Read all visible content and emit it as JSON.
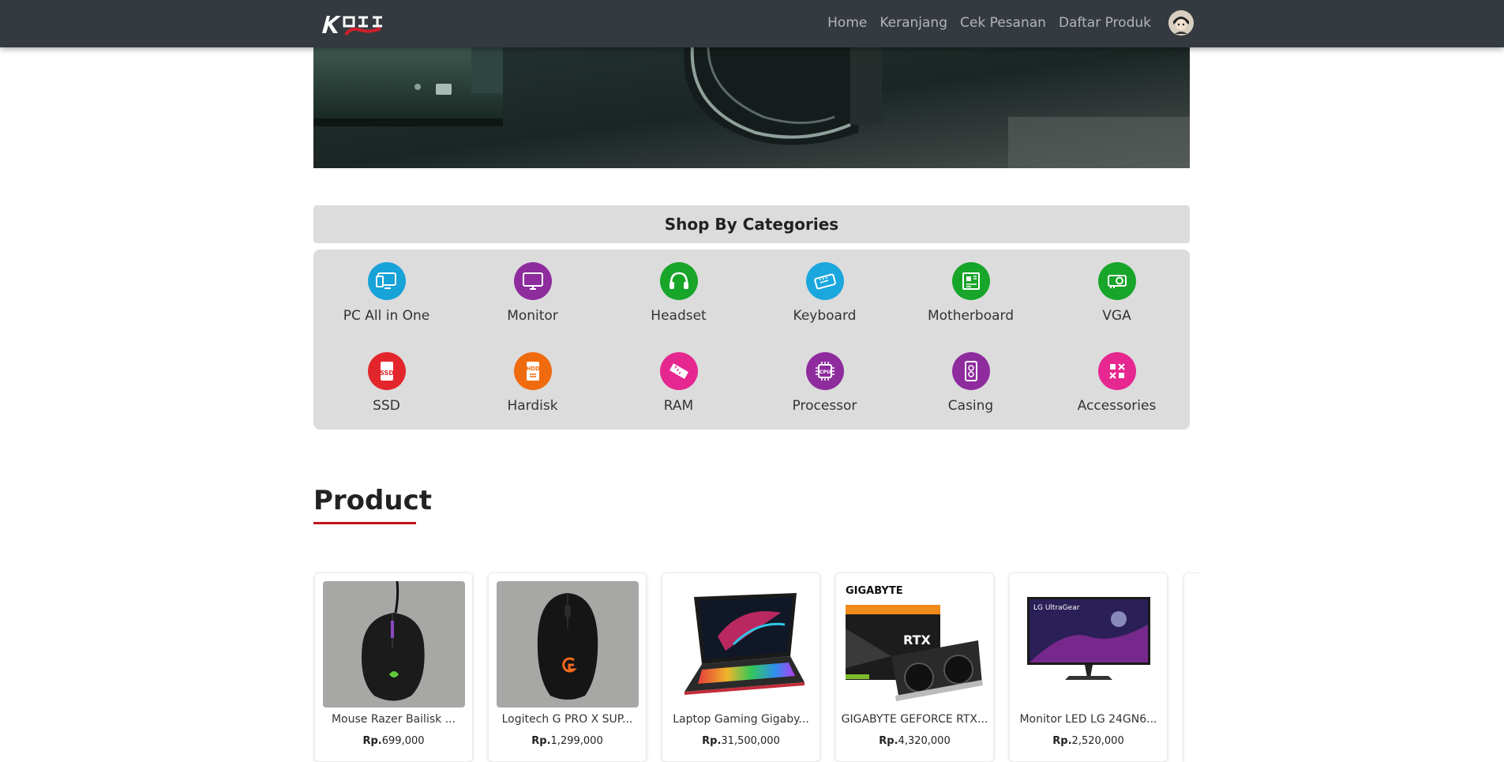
{
  "navbar": {
    "brand_alt": "KOJI Store",
    "links": [
      "Home",
      "Keranjang",
      "Cek Pesanan",
      "Daftar Produk"
    ]
  },
  "categories": {
    "header": "Shop By Categories",
    "items": [
      {
        "label": "PC All in One",
        "icon": "pc-all-in-one-icon",
        "color": "#17a2d8"
      },
      {
        "label": "Monitor",
        "icon": "monitor-icon",
        "color": "#8e2c9e"
      },
      {
        "label": "Headset",
        "icon": "headset-icon",
        "color": "#17a52a"
      },
      {
        "label": "Keyboard",
        "icon": "keyboard-icon",
        "color": "#1aa7de"
      },
      {
        "label": "Motherboard",
        "icon": "motherboard-icon",
        "color": "#17a52a"
      },
      {
        "label": "VGA",
        "icon": "vga-icon",
        "color": "#17a52a"
      },
      {
        "label": "SSD",
        "icon": "ssd-icon",
        "color": "#e3262c"
      },
      {
        "label": "Hardisk",
        "icon": "hardisk-icon",
        "color": "#f06a0e"
      },
      {
        "label": "RAM",
        "icon": "ram-icon",
        "color": "#e5278f"
      },
      {
        "label": "Processor",
        "icon": "processor-icon",
        "color": "#8e2c9e"
      },
      {
        "label": "Casing",
        "icon": "casing-icon",
        "color": "#8e2c9e"
      },
      {
        "label": "Accessories",
        "icon": "accessories-icon",
        "color": "#e5278f"
      }
    ]
  },
  "product_section": {
    "title": "Product",
    "accent_color": "#c0151c"
  },
  "products": [
    {
      "name": "Mouse Razer Bailisk ...",
      "price_prefix": "Rp.",
      "price": "699,000"
    },
    {
      "name": "Logitech G PRO X SUP...",
      "price_prefix": "Rp.",
      "price": "1,299,000"
    },
    {
      "name": "Laptop Gaming Gigaby...",
      "price_prefix": "Rp.",
      "price": "31,500,000"
    },
    {
      "name": "GIGABYTE GEFORCE RTX...",
      "price_prefix": "Rp.",
      "price": "4,320,000",
      "image_text": "GIGABYTE"
    },
    {
      "name": "Monitor LED LG 24GN6...",
      "price_prefix": "Rp.",
      "price": "2,520,000",
      "image_text": "LG UltraGear"
    }
  ]
}
